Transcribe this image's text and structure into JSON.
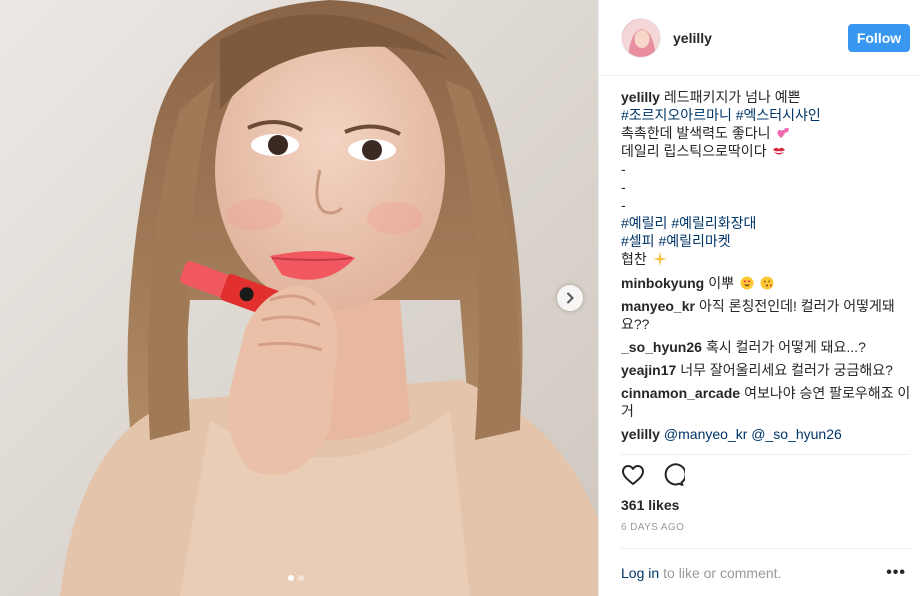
{
  "post": {
    "username": "yelilly",
    "follow_label": "Follow",
    "caption": {
      "username": "yelilly",
      "line1": "레드패키지가 넘나 예쁜",
      "line2_tags": [
        "#조르지오아르마니",
        "#엑스터시샤인"
      ],
      "line3": "촉촉한데 발색력도 좋다니",
      "line4": "데일리 립스틱으로딱이다",
      "dashes": [
        "-",
        "-",
        "-"
      ],
      "tags_line1": [
        "#예릴리",
        "#예릴리화장대"
      ],
      "tags_line2": [
        "#셀피",
        "#예릴리마켓"
      ],
      "line_last": "협찬"
    },
    "comments": [
      {
        "user": "minbokyung",
        "text": "이뿌"
      },
      {
        "user": "manyeo_kr",
        "text": "아직 론칭전인데! 컬러가 어떻게돼요??"
      },
      {
        "user": "_so_hyun26",
        "text": "혹시 컬러가 어떻게 돼요...?"
      },
      {
        "user": "yeajin17",
        "text": "너무 잘어울리세요 컬러가 궁금해요?"
      },
      {
        "user": "cinnamon_arcade",
        "text": "여보나야 승연 팔로우해죠 이거"
      },
      {
        "user": "yelilly",
        "mentions": [
          "@manyeo_kr",
          "@_so_hyun26"
        ]
      }
    ],
    "likes": "361 likes",
    "time": "6 DAYS AGO",
    "login_link": "Log in",
    "login_rest": "to like or comment.",
    "more_label": "•••",
    "icons": {
      "heart": "heart-outline-icon",
      "comment": "comment-bubble-icon",
      "next": "chevron-right-icon",
      "more": "more-dots-icon"
    },
    "carousel": {
      "count": 2,
      "active": 0
    },
    "colors": {
      "accent": "#3897f0",
      "tag": "#003569",
      "muted": "#999999",
      "text": "#262626"
    }
  }
}
